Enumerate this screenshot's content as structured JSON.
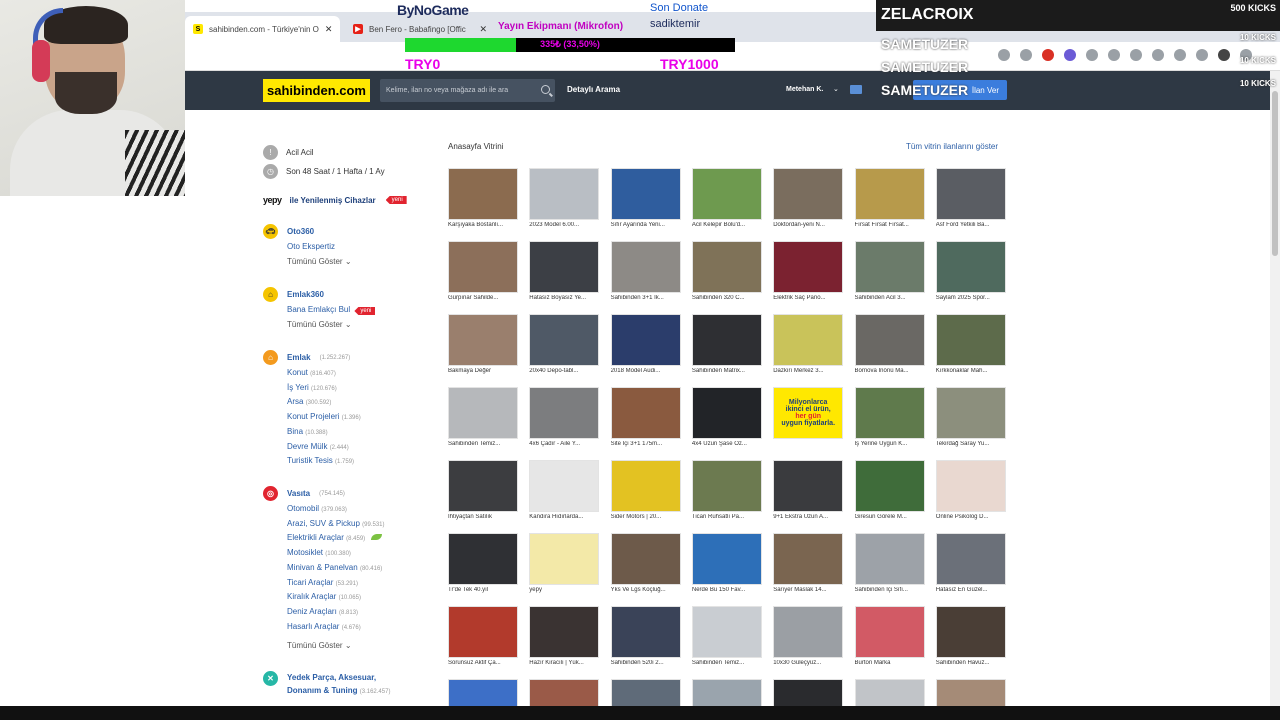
{
  "browser": {
    "tab1": "sahibinden.com - Türkiye'nin O",
    "tab2": "Ben Fero - Babafingo [Offic"
  },
  "header": {
    "logo": "sahibinden.com",
    "search_placeholder": "Kelime, ilan no veya mağaza adı ile ara",
    "detailed_search": "Detaylı Arama",
    "username": "Metehan K.",
    "post_ad": "İlan Ver"
  },
  "sidebar": {
    "acil": "Acil Acil",
    "recent": "Son 48 Saat / 1 Hafta / 1 Ay",
    "yepy": "yepy",
    "yepy_text": "ile Yenilenmiş Cihazlar",
    "new_badge": "yeni",
    "oto360": "Oto360",
    "oto_ekspertiz": "Oto Ekspertiz",
    "show_all": "Tümünü Göster",
    "emlak360": "Emlak360",
    "bana_emlakci": "Bana Emlakçı Bul",
    "emlak": {
      "label": "Emlak",
      "count": "(1.252.267)"
    },
    "emlak_items": [
      {
        "label": "Konut",
        "count": "(816.407)"
      },
      {
        "label": "İş Yeri",
        "count": "(120.676)"
      },
      {
        "label": "Arsa",
        "count": "(300.592)"
      },
      {
        "label": "Konut Projeleri",
        "count": "(1.396)"
      },
      {
        "label": "Bina",
        "count": "(10.388)"
      },
      {
        "label": "Devre Mülk",
        "count": "(2.444)"
      },
      {
        "label": "Turistik Tesis",
        "count": "(1.759)"
      }
    ],
    "vasita": {
      "label": "Vasıta",
      "count": "(754.145)"
    },
    "vasita_items": [
      {
        "label": "Otomobil",
        "count": "(379.063)"
      },
      {
        "label": "Arazi, SUV & Pickup",
        "count": "(99.531)"
      },
      {
        "label": "Elektrikli Araçlar",
        "count": "(8.459)"
      },
      {
        "label": "Motosiklet",
        "count": "(100.380)"
      },
      {
        "label": "Minivan & Panelvan",
        "count": "(80.416)"
      },
      {
        "label": "Ticari Araçlar",
        "count": "(53.291)"
      },
      {
        "label": "Kiralık Araçlar",
        "count": "(10.065)"
      },
      {
        "label": "Deniz Araçları",
        "count": "(8.813)"
      },
      {
        "label": "Hasarlı Araçlar",
        "count": "(4.676)"
      }
    ],
    "yedek": {
      "label1": "Yedek Parça, Aksesuar,",
      "label2": "Donanım & Tuning",
      "count": "(3.162.457)"
    }
  },
  "main": {
    "vitrin_title": "Anasayfa Vitrini",
    "vitrin_all": "Tüm vitrin ilanlarını göster",
    "cards": [
      {
        "cap": "Karşıyaka Bostanlı...",
        "color": "#8b6b4f"
      },
      {
        "cap": "2023 Model 6.00...",
        "color": "#b9bec4"
      },
      {
        "cap": "Sıfır Ayarında Yeni...",
        "color": "#2f5d9e"
      },
      {
        "cap": "Acil Kelepir Bolu'd...",
        "color": "#6e9a4f"
      },
      {
        "cap": "Doktordan-yeni N...",
        "color": "#7a6d5e"
      },
      {
        "cap": "Fırsat Fırsat Fırsat...",
        "color": "#b79a4b"
      },
      {
        "cap": "Asf Ford Yetkili Ba...",
        "color": "#5a5d63"
      },
      {
        "cap": "Gürpınar Sahilde...",
        "color": "#8c6f5a"
      },
      {
        "cap": "Hatasız Boyasız Ye...",
        "color": "#3c3f45"
      },
      {
        "cap": "Sahibinden 3+1 İk...",
        "color": "#8d8a86"
      },
      {
        "cap": "Sahibinden 320 C...",
        "color": "#7f7258"
      },
      {
        "cap": "Elektrik Saç Pano...",
        "color": "#7b2230"
      },
      {
        "cap": "Sahibinden Acil 3...",
        "color": "#6b7b6a"
      },
      {
        "cap": "Saylam 2025 Spor...",
        "color": "#4f6a5e"
      },
      {
        "cap": "Bakmaya Değer",
        "color": "#9a7f6d"
      },
      {
        "cap": "20x40 Depo-tabl...",
        "color": "#4f5966"
      },
      {
        "cap": "2018 Model Audi...",
        "color": "#2b3d6b"
      },
      {
        "cap": "Sahibinden Matrix...",
        "color": "#2e2f33"
      },
      {
        "cap": "Dazkırı Merkez 3...",
        "color": "#c9c35a"
      },
      {
        "cap": "Bornova İnönü Ma...",
        "color": "#6a6864"
      },
      {
        "cap": "Kırkkonaklar Mah...",
        "color": "#5d6b4b"
      },
      {
        "cap": "Sahibinden Temiz...",
        "color": "#b6b8bb"
      },
      {
        "cap": "4x6 Çadır - Aile Y...",
        "color": "#7c7d7f"
      },
      {
        "cap": "Site İçi 3+1 175m...",
        "color": "#8a5a3f"
      },
      {
        "cap": "4x4 Uzun Şase Öz...",
        "color": "#222428"
      },
      {
        "cap": "",
        "color": "#ffe800",
        "promo": true
      },
      {
        "cap": "İş Yerine Uygun K...",
        "color": "#5f7a4c"
      },
      {
        "cap": "Tekirdağ Saray Yu...",
        "color": "#8c8f7d"
      },
      {
        "cap": "İhtiyaçtan Satılık",
        "color": "#3c3d40"
      },
      {
        "cap": "Kandıra Hıdırlarda...",
        "color": "#e6e6e6"
      },
      {
        "cap": "Sider Motors | 20...",
        "color": "#e3c222"
      },
      {
        "cap": "Ticari Ruhsatlı Pa...",
        "color": "#6c7a50"
      },
      {
        "cap": "9+1 Ekstra Uzun A...",
        "color": "#3a3b3e"
      },
      {
        "cap": "Giresun Görele M...",
        "color": "#3f6c3a"
      },
      {
        "cap": "Online Psikolog D...",
        "color": "#e9d8d0"
      },
      {
        "cap": "Tr'de Tek 40.yıl",
        "color": "#2f3034"
      },
      {
        "cap": "yepy",
        "color": "#f3e9a8"
      },
      {
        "cap": "Yks Ve Lgs Koçluğ...",
        "color": "#6d5a4a"
      },
      {
        "cap": "Nerde Bu 150 Fav...",
        "color": "#2d6fb8"
      },
      {
        "cap": "Sarıyer Maslak 14...",
        "color": "#7a6550"
      },
      {
        "cap": "Sahibinden İçi Sıfı...",
        "color": "#9da2a8"
      },
      {
        "cap": "Hatasız En Güzel...",
        "color": "#6b7079"
      },
      {
        "cap": "Sorunsuz Aktif Ça...",
        "color": "#b23a2c"
      },
      {
        "cap": "Hazır Kiracılı | Yük...",
        "color": "#3a3332"
      },
      {
        "cap": "Sahibinden 520i 2...",
        "color": "#3a4358"
      },
      {
        "cap": "Sahibinden Temiz...",
        "color": "#c9cdd2"
      },
      {
        "cap": "10x30 Güleçyüz...",
        "color": "#9b9fa4"
      },
      {
        "cap": "Burton Marka",
        "color": "#d25a65"
      },
      {
        "cap": "Sahibinden Havuz...",
        "color": "#4a3e36"
      },
      {
        "cap": "",
        "color": "#3d6fc7"
      },
      {
        "cap": "",
        "color": "#9a5a48"
      },
      {
        "cap": "",
        "color": "#5f6b79"
      },
      {
        "cap": "",
        "color": "#9aa4ad"
      },
      {
        "cap": "",
        "color": "#2a2b2e"
      },
      {
        "cap": "",
        "color": "#c1c4c8"
      },
      {
        "cap": "",
        "color": "#a58b77"
      }
    ],
    "promo_lines": [
      "Milyonlarca",
      "ikinci el ürün,",
      "her gün",
      "uygun fiyatlarla."
    ]
  },
  "overlay": {
    "donate_logo": "ByNoGame",
    "donate_sub": "Yayın Ekipmanı (Mikrofon)",
    "last_donate_label": "Son Donate",
    "last_donor": "sadiktemir",
    "progress_text": "335₺ (33,50%)",
    "progress_fraction": 0.335,
    "goal_min": "TRY0",
    "goal_max": "TRY1000",
    "kicks_top_name": "ZELACROIX",
    "kicks_top_value": "500 KICKS",
    "kicks": [
      {
        "name": "SAMETUZER",
        "value": "10 KICKS"
      },
      {
        "name": "SAMETUZER",
        "value": "10 KICKS"
      },
      {
        "name": "SAMETUZER",
        "value": "10 KICKS"
      }
    ]
  }
}
